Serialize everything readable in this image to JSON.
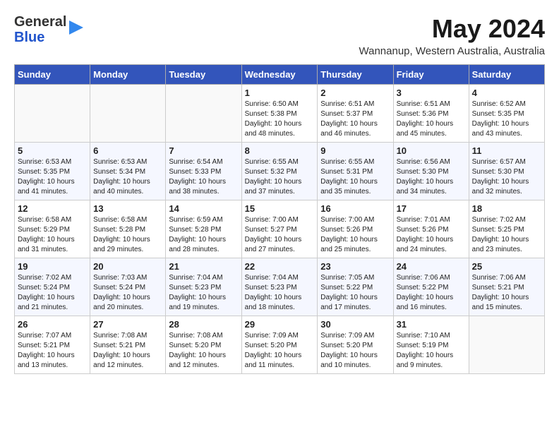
{
  "header": {
    "logo_general": "General",
    "logo_blue": "Blue",
    "month_year": "May 2024",
    "location": "Wannanup, Western Australia, Australia"
  },
  "weekdays": [
    "Sunday",
    "Monday",
    "Tuesday",
    "Wednesday",
    "Thursday",
    "Friday",
    "Saturday"
  ],
  "weeks": [
    [
      {
        "day": "",
        "sunrise": "",
        "sunset": "",
        "daylight": ""
      },
      {
        "day": "",
        "sunrise": "",
        "sunset": "",
        "daylight": ""
      },
      {
        "day": "",
        "sunrise": "",
        "sunset": "",
        "daylight": ""
      },
      {
        "day": "1",
        "sunrise": "6:50 AM",
        "sunset": "5:38 PM",
        "daylight": "10 hours and 48 minutes."
      },
      {
        "day": "2",
        "sunrise": "6:51 AM",
        "sunset": "5:37 PM",
        "daylight": "10 hours and 46 minutes."
      },
      {
        "day": "3",
        "sunrise": "6:51 AM",
        "sunset": "5:36 PM",
        "daylight": "10 hours and 45 minutes."
      },
      {
        "day": "4",
        "sunrise": "6:52 AM",
        "sunset": "5:35 PM",
        "daylight": "10 hours and 43 minutes."
      }
    ],
    [
      {
        "day": "5",
        "sunrise": "6:53 AM",
        "sunset": "5:35 PM",
        "daylight": "10 hours and 41 minutes."
      },
      {
        "day": "6",
        "sunrise": "6:53 AM",
        "sunset": "5:34 PM",
        "daylight": "10 hours and 40 minutes."
      },
      {
        "day": "7",
        "sunrise": "6:54 AM",
        "sunset": "5:33 PM",
        "daylight": "10 hours and 38 minutes."
      },
      {
        "day": "8",
        "sunrise": "6:55 AM",
        "sunset": "5:32 PM",
        "daylight": "10 hours and 37 minutes."
      },
      {
        "day": "9",
        "sunrise": "6:55 AM",
        "sunset": "5:31 PM",
        "daylight": "10 hours and 35 minutes."
      },
      {
        "day": "10",
        "sunrise": "6:56 AM",
        "sunset": "5:30 PM",
        "daylight": "10 hours and 34 minutes."
      },
      {
        "day": "11",
        "sunrise": "6:57 AM",
        "sunset": "5:30 PM",
        "daylight": "10 hours and 32 minutes."
      }
    ],
    [
      {
        "day": "12",
        "sunrise": "6:58 AM",
        "sunset": "5:29 PM",
        "daylight": "10 hours and 31 minutes."
      },
      {
        "day": "13",
        "sunrise": "6:58 AM",
        "sunset": "5:28 PM",
        "daylight": "10 hours and 29 minutes."
      },
      {
        "day": "14",
        "sunrise": "6:59 AM",
        "sunset": "5:28 PM",
        "daylight": "10 hours and 28 minutes."
      },
      {
        "day": "15",
        "sunrise": "7:00 AM",
        "sunset": "5:27 PM",
        "daylight": "10 hours and 27 minutes."
      },
      {
        "day": "16",
        "sunrise": "7:00 AM",
        "sunset": "5:26 PM",
        "daylight": "10 hours and 25 minutes."
      },
      {
        "day": "17",
        "sunrise": "7:01 AM",
        "sunset": "5:26 PM",
        "daylight": "10 hours and 24 minutes."
      },
      {
        "day": "18",
        "sunrise": "7:02 AM",
        "sunset": "5:25 PM",
        "daylight": "10 hours and 23 minutes."
      }
    ],
    [
      {
        "day": "19",
        "sunrise": "7:02 AM",
        "sunset": "5:24 PM",
        "daylight": "10 hours and 21 minutes."
      },
      {
        "day": "20",
        "sunrise": "7:03 AM",
        "sunset": "5:24 PM",
        "daylight": "10 hours and 20 minutes."
      },
      {
        "day": "21",
        "sunrise": "7:04 AM",
        "sunset": "5:23 PM",
        "daylight": "10 hours and 19 minutes."
      },
      {
        "day": "22",
        "sunrise": "7:04 AM",
        "sunset": "5:23 PM",
        "daylight": "10 hours and 18 minutes."
      },
      {
        "day": "23",
        "sunrise": "7:05 AM",
        "sunset": "5:22 PM",
        "daylight": "10 hours and 17 minutes."
      },
      {
        "day": "24",
        "sunrise": "7:06 AM",
        "sunset": "5:22 PM",
        "daylight": "10 hours and 16 minutes."
      },
      {
        "day": "25",
        "sunrise": "7:06 AM",
        "sunset": "5:21 PM",
        "daylight": "10 hours and 15 minutes."
      }
    ],
    [
      {
        "day": "26",
        "sunrise": "7:07 AM",
        "sunset": "5:21 PM",
        "daylight": "10 hours and 13 minutes."
      },
      {
        "day": "27",
        "sunrise": "7:08 AM",
        "sunset": "5:21 PM",
        "daylight": "10 hours and 12 minutes."
      },
      {
        "day": "28",
        "sunrise": "7:08 AM",
        "sunset": "5:20 PM",
        "daylight": "10 hours and 12 minutes."
      },
      {
        "day": "29",
        "sunrise": "7:09 AM",
        "sunset": "5:20 PM",
        "daylight": "10 hours and 11 minutes."
      },
      {
        "day": "30",
        "sunrise": "7:09 AM",
        "sunset": "5:20 PM",
        "daylight": "10 hours and 10 minutes."
      },
      {
        "day": "31",
        "sunrise": "7:10 AM",
        "sunset": "5:19 PM",
        "daylight": "10 hours and 9 minutes."
      },
      {
        "day": "",
        "sunrise": "",
        "sunset": "",
        "daylight": ""
      }
    ]
  ]
}
